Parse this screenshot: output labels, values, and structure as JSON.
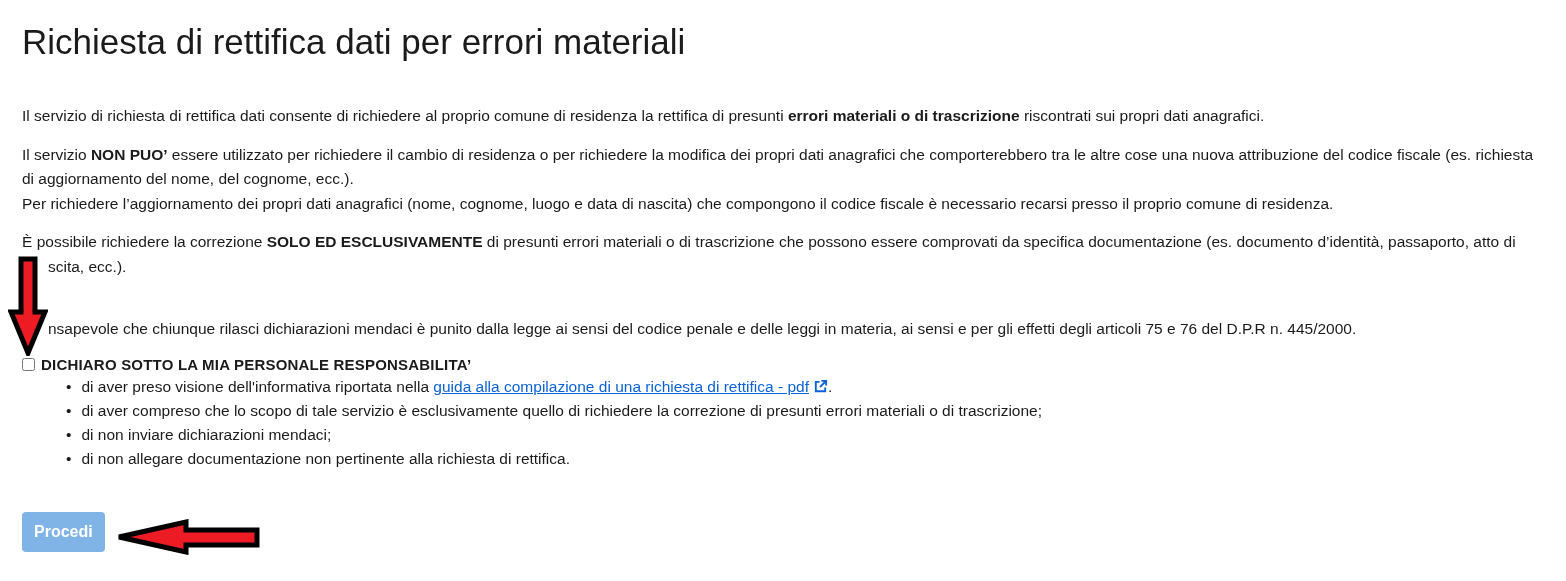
{
  "title": "Richiesta di rettifica dati per errori materiali",
  "paragraphs": [
    {
      "lines": [
        "Il servizio di richiesta di rettifica dati consente di richiedere al proprio comune di residenza la rettifica di presunti **errori materiali o di trascrizione** riscontrati sui propri dati anagrafici."
      ]
    },
    {
      "lines": [
        "Il servizio **NON PUO’** essere utilizzato per richiedere il cambio di residenza o per richiedere la modifica dei propri dati anagrafici che comporterebbero tra le altre cose una nuova attribuzione del codice fiscale (es. richiesta di aggiornamento del nome, del cognome, ecc.).",
        "Per richiedere l’aggiornamento dei propri dati anagrafici (nome, cognome, luogo e data di nascita) che compongono il codice fiscale è necessario recarsi presso il proprio comune di residenza."
      ]
    },
    {
      "lines": [
        "È possibile richiedere la correzione **SOLO ED ESCLUSIVAMENTE** di presunti errori materiali o di trascrizione che possono essere comprovati da specifica documentazione (es. documento d’identità, passaporto, atto di",
        "scita, ecc.)."
      ]
    },
    {
      "lines": [
        "nsapevole che chiunque rilasci dichiarazioni mendaci è punito dalla legge ai sensi del codice penale e delle leggi in materia, ai sensi e per gli effetti degli articoli 75 e 76 del D.P.R n. 445/2000."
      ]
    }
  ],
  "declaration": {
    "label": "DICHIARO SOTTO LA MIA PERSONALE RESPONSABILITA’",
    "checked": false
  },
  "bullets": [
    {
      "marker": "•",
      "text": "di aver preso visione dell'informativa riportata nella",
      "link": "guida alla compilazione di una richiesta di rettifica - pdf",
      "after": "."
    },
    {
      "marker": "•",
      "text": "di aver compreso che lo scopo di tale servizio è esclusivamente quello di richiedere la correzione di presunti errori materiali o di trascrizione;"
    },
    {
      "marker": "•",
      "text": "di non inviare dichiarazioni mendaci;"
    },
    {
      "marker": "•",
      "text": "di non allegare documentazione non pertinente alla richiesta di rettifica."
    }
  ],
  "button": {
    "label": "Procedi",
    "disabled": true
  },
  "annotations": [
    {
      "kind": "down-arrow"
    },
    {
      "kind": "left-arrow"
    }
  ]
}
